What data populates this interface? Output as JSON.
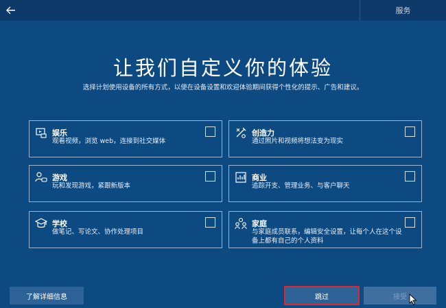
{
  "topbar": {
    "back_icon": "arrow-left-icon",
    "title": "服务"
  },
  "heading": "让我们自定义你的体验",
  "subheading": "选择计划使用设备的所有方式，以便在设备设置和欢迎体验期间获得个性化的提示、广告和建议。",
  "cards": [
    {
      "id": "entertainment",
      "title": "娱乐",
      "desc": "观看视频，浏览 web，连接到社交媒体",
      "icon": "entertainment-icon",
      "checked": false
    },
    {
      "id": "creativity",
      "title": "创造力",
      "desc": "通过照片和视频将想法变为现实",
      "icon": "creativity-icon",
      "checked": false
    },
    {
      "id": "gaming",
      "title": "游戏",
      "desc": "玩和发现游戏，紧跟新版本",
      "icon": "gaming-icon",
      "checked": false
    },
    {
      "id": "business",
      "title": "商业",
      "desc": "追踪开支、管理业务、与客户聊天",
      "icon": "business-icon",
      "checked": false
    },
    {
      "id": "school",
      "title": "学校",
      "desc": "做笔记、写论文、协作处理项目",
      "icon": "school-icon",
      "checked": false
    },
    {
      "id": "family",
      "title": "家庭",
      "desc": "与家庭成员联系，编辑安全设置，让每个人在这个设备上都有自己的个人资料",
      "icon": "family-icon",
      "checked": false
    }
  ],
  "buttons": {
    "learn_more": "了解详细信息",
    "skip": "跳过",
    "accept": "接受"
  },
  "colors": {
    "background": "#0d4a82",
    "highlight_border": "#e0262e"
  }
}
